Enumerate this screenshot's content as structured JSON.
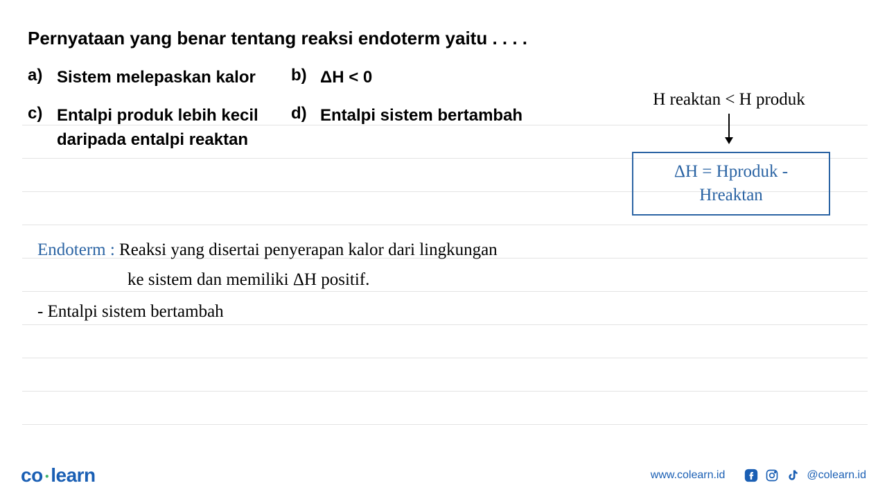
{
  "question": "Pernyataan yang benar tentang reaksi endoterm yaitu . . . .",
  "options": {
    "a": {
      "label": "a)",
      "text": "Sistem melepaskan kalor"
    },
    "b": {
      "label": "b)",
      "text": "ΔH < 0"
    },
    "c": {
      "label": "c)",
      "text": "Entalpi produk lebih kecil daripada entalpi reaktan"
    },
    "d": {
      "label": "d)",
      "text": "Entalpi sistem bertambah"
    }
  },
  "annotation": {
    "comparison": "H reaktan < H produk",
    "formula": "ΔH = Hproduk - Hreaktan"
  },
  "explanation": {
    "term_label": "Endoterm :",
    "line1": "Reaksi yang disertai penyerapan kalor dari  lingkungan",
    "line2": "ke sistem dan memiliki ΔH positif.",
    "line3": "- Entalpi sistem bertambah"
  },
  "footer": {
    "logo_co": "co",
    "logo_learn": "learn",
    "url": "www.colearn.id",
    "handle": "@colearn.id"
  }
}
